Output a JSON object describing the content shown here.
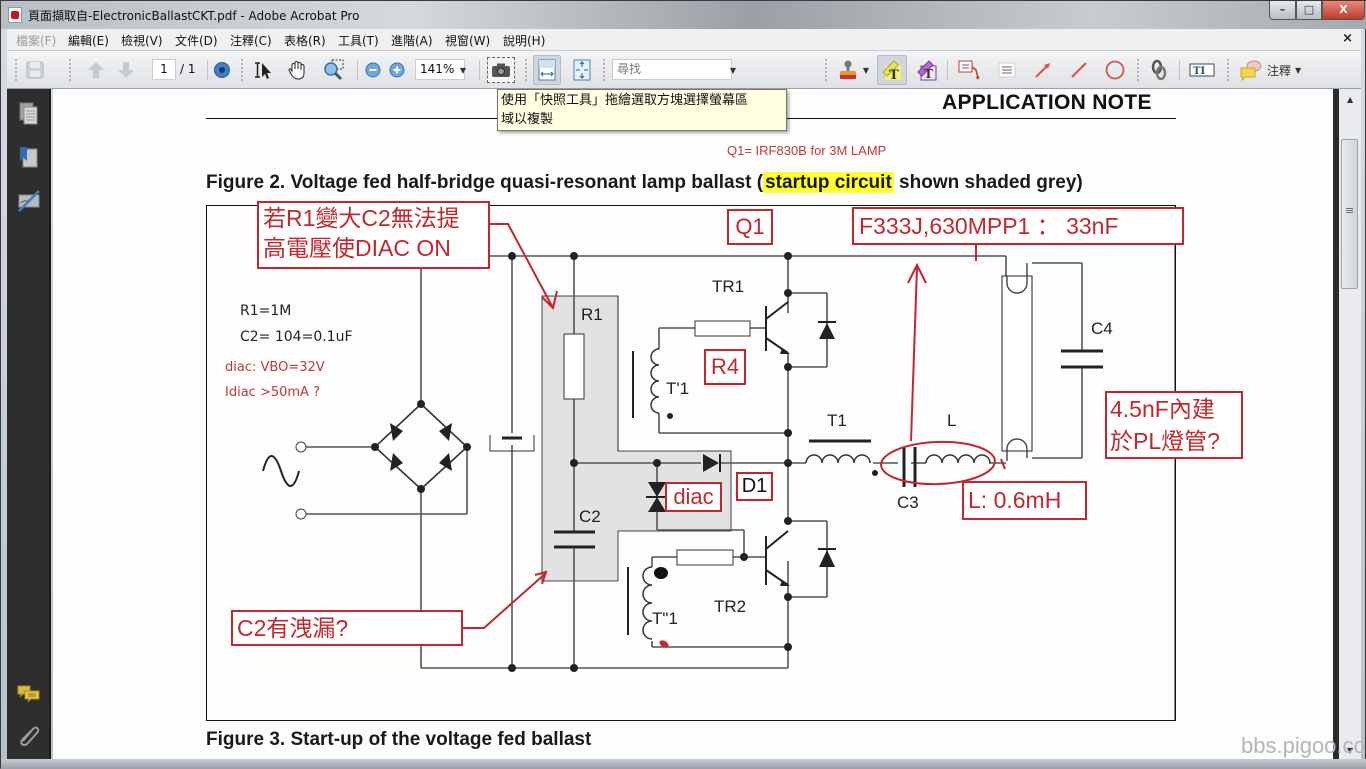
{
  "window": {
    "title": "頁面擷取自-ElectronicBallastCKT.pdf - Adobe Acrobat Pro",
    "controls": {
      "minimize": "–",
      "maximize": "□",
      "close": "X"
    }
  },
  "menu": {
    "items": [
      "檔案(F)",
      "編輯(E)",
      "檢視(V)",
      "文件(D)",
      "注釋(C)",
      "表格(R)",
      "工具(T)",
      "進階(A)",
      "視窗(W)",
      "說明(H)"
    ],
    "close": "×"
  },
  "toolbar": {
    "page_current": "1",
    "page_total": "/ 1",
    "zoom_value": "141%",
    "search_placeholder": "尋找",
    "comment_label": "注釋",
    "icons": [
      "save-icon",
      "prev-page-icon",
      "next-page-icon",
      "navigate-icon",
      "select-text-icon",
      "hand-icon",
      "marquee-zoom-icon",
      "zoom-out-icon",
      "zoom-in-icon",
      "snapshot-icon",
      "fit-width-icon",
      "fit-page-icon",
      "stamp-icon",
      "highlight-text-icon",
      "underline-text-icon",
      "note-callout-icon",
      "text-box-icon",
      "arrow-icon",
      "line-icon",
      "oval-icon",
      "link-icon",
      "typewriter-icon",
      "comment-icon"
    ]
  },
  "tooltip": {
    "line1": "使用「快照工具」拖繪選取方塊選擇螢幕區",
    "line2": "域以複製"
  },
  "document": {
    "header": "APPLICATION NOTE",
    "q1_note": "Q1=  IRF830B for 3M LAMP",
    "figure2_caption_pre": "Figure 2. Voltage fed half-bridge quasi-resonant lamp ballast (",
    "figure2_caption_highlight": "startup circuit",
    "figure2_caption_post": " shown shaded grey)",
    "figure3_caption": "Figure 3. Start-up of the voltage fed ballast",
    "params": {
      "r1": "R1=1M",
      "c2": "C2= 104=0.1uF",
      "diac_vbo": "diac: VBO=32V",
      "idiac": "Idiac >50mA  ?"
    },
    "component_labels": {
      "r1": "R1",
      "c2": "C2",
      "tr1": "TR1",
      "tr2": "TR2",
      "t1_primary": "T'1",
      "t1_secondary": "T\"1",
      "t1": "T1",
      "l": "L",
      "c3": "C3",
      "c4": "C4",
      "d1": "D1"
    },
    "annotations": {
      "r1_note_line1": "若R1變大C2無法提",
      "r1_note_line2": "高電壓使DIAC ON",
      "q1_box": "Q1",
      "r4_box": "R4",
      "diac_box": "diac",
      "cap_box": "F333J,630MPP1 ：  33nF",
      "pl_note_line1": "4.5nF內建",
      "pl_note_line2": "於PL燈管?",
      "l_box": "L: 0.6mH",
      "c2_leak": "C2有洩漏?"
    }
  },
  "watermark": "bbs.pigoo.com",
  "colors": {
    "annotation_red": "#c0282e",
    "highlight_yellow": "#ffff33",
    "shade_grey": "#e2e2e2",
    "tooltip_bg": "#ffffe1"
  }
}
